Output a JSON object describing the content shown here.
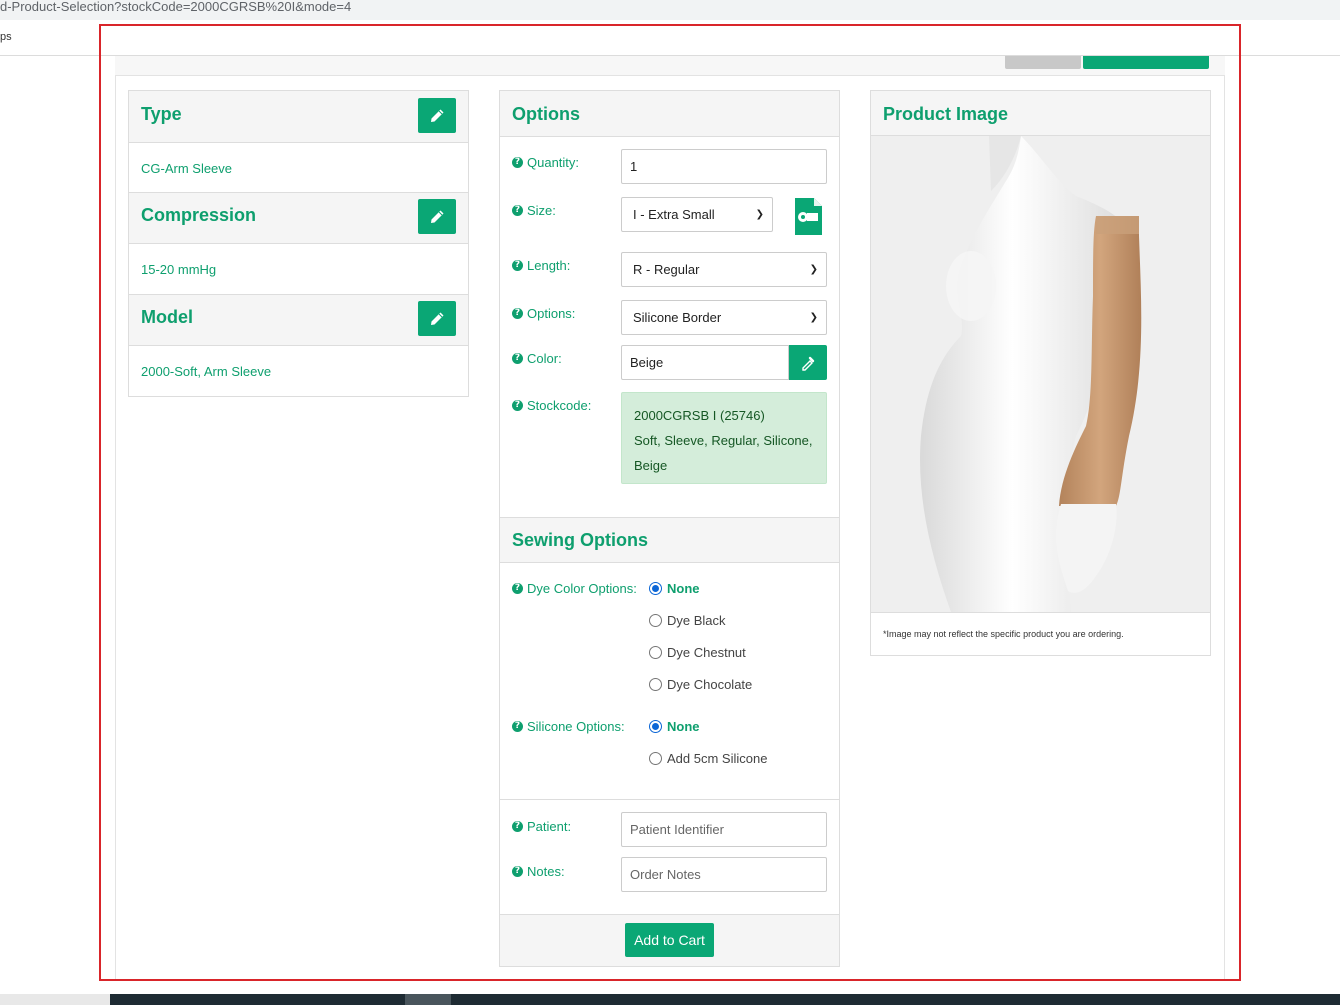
{
  "browser": {
    "url": "d-Product-Selection?stockCode=2000CGRSB%20I&mode=4",
    "bookmark": "ps"
  },
  "type_panel": {
    "title": "Type",
    "value": "CG-Arm Sleeve"
  },
  "compression_panel": {
    "title": "Compression",
    "value": "15-20 mmHg"
  },
  "model_panel": {
    "title": "Model",
    "value": "2000-Soft, Arm Sleeve"
  },
  "options_panel": {
    "title": "Options",
    "quantity": {
      "label": "Quantity:",
      "value": "1"
    },
    "size": {
      "label": "Size:",
      "value": "I - Extra Small"
    },
    "length": {
      "label": "Length:",
      "value": "R - Regular"
    },
    "options": {
      "label": "Options:",
      "value": "Silicone Border"
    },
    "color": {
      "label": "Color:",
      "value": "Beige"
    },
    "stockcode": {
      "label": "Stockcode:",
      "line1": "2000CGRSB I (25746)",
      "line2": "Soft, Sleeve, Regular, Silicone,",
      "line3": "Beige"
    }
  },
  "sewing_panel": {
    "title": "Sewing Options",
    "dye_label": "Dye Color Options:",
    "dye_options": [
      "None",
      "Dye Black",
      "Dye Chestnut",
      "Dye Chocolate"
    ],
    "dye_selected": "None",
    "silicone_label": "Silicone Options:",
    "silicone_options": [
      "None",
      "Add 5cm Silicone"
    ],
    "silicone_selected": "None"
  },
  "order_panel": {
    "patient_label": "Patient:",
    "patient_placeholder": "Patient Identifier",
    "notes_label": "Notes:",
    "notes_placeholder": "Order Notes",
    "add_to_cart": "Add to Cart"
  },
  "image_panel": {
    "title": "Product Image",
    "note": "*Image may not reflect the specific product you are ordering."
  },
  "colors": {
    "accent": "#0aa775",
    "text_green": "#0e9f6e",
    "stock_bg": "#d4edda",
    "frame_red": "#d9252a"
  }
}
